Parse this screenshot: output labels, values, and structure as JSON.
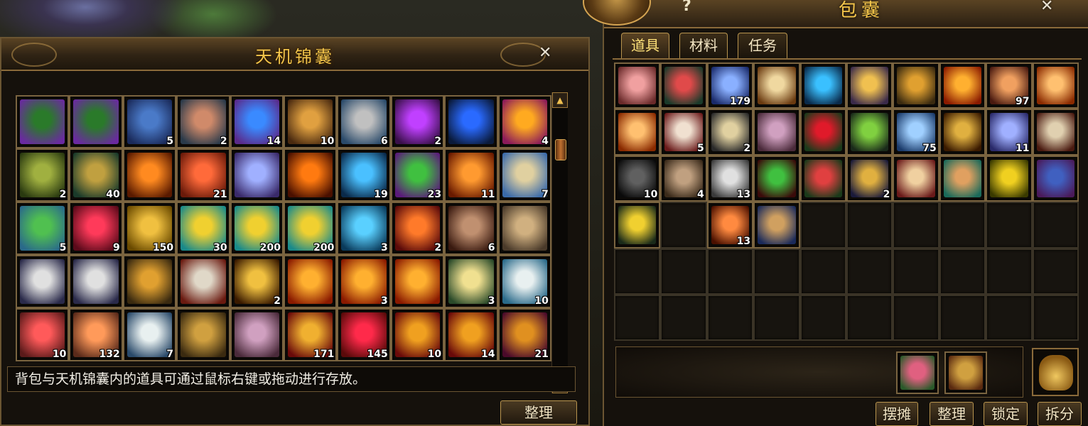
{
  "left_panel": {
    "title": "天机锦囊",
    "close_label": "✕",
    "scroll_up": "▲",
    "scroll_down": "▼",
    "hint": "背包与天机锦囊内的道具可通过鼠标右键或拖动进行存放。",
    "sort_button": "整理",
    "slots": [
      {
        "icon": "green-jade-talisman-icon",
        "count": "",
        "colors": [
          "#2a7a2a",
          "#6a2aa0"
        ]
      },
      {
        "icon": "green-jade-talisman-icon",
        "count": "",
        "colors": [
          "#2a7a2a",
          "#6a2aa0"
        ]
      },
      {
        "icon": "blue-ribbon-icon",
        "count": "5",
        "colors": [
          "#4a7ac8",
          "#1a2a5a"
        ]
      },
      {
        "icon": "pink-ribbon-icon",
        "count": "2",
        "colors": [
          "#d08a6a",
          "#2a3a4a"
        ]
      },
      {
        "icon": "blue-orb-icon",
        "count": "14",
        "colors": [
          "#3a8aff",
          "#5a2a8a"
        ]
      },
      {
        "icon": "golden-orb-icon",
        "count": "10",
        "colors": [
          "#e0a040",
          "#4a2a10"
        ]
      },
      {
        "icon": "jade-ring-icon",
        "count": "6",
        "colors": [
          "#c0c0c0",
          "#2a4a6a"
        ]
      },
      {
        "icon": "purple-gem-icon",
        "count": "2",
        "colors": [
          "#c040ff",
          "#3a104a"
        ]
      },
      {
        "icon": "blue-rune-icon",
        "count": "",
        "colors": [
          "#2a6aff",
          "#0a1a3a"
        ]
      },
      {
        "icon": "fire-swirl-icon",
        "count": "4",
        "colors": [
          "#ffaa20",
          "#8a1a5a"
        ]
      },
      {
        "icon": "bamboo-scroll-icon",
        "count": "2",
        "colors": [
          "#a0b040",
          "#2a3a10"
        ]
      },
      {
        "icon": "bronze-coin-icon",
        "count": "40",
        "colors": [
          "#c0a040",
          "#1a3a2a"
        ]
      },
      {
        "icon": "flame-orb-icon",
        "count": "",
        "colors": [
          "#ff8a20",
          "#5a1a00"
        ]
      },
      {
        "icon": "red-fan-icon",
        "count": "21",
        "colors": [
          "#ff6a3a",
          "#6a1a0a"
        ]
      },
      {
        "icon": "crystal-gem-icon",
        "count": "",
        "colors": [
          "#a0b0ff",
          "#3a2a6a"
        ]
      },
      {
        "icon": "flame-orb-icon",
        "count": "",
        "colors": [
          "#ff7a10",
          "#4a1000"
        ]
      },
      {
        "icon": "water-drop-icon",
        "count": "19",
        "colors": [
          "#4ac0ff",
          "#0a2a4a"
        ]
      },
      {
        "icon": "green-leaf-icon",
        "count": "23",
        "colors": [
          "#40c040",
          "#5a1a7a"
        ]
      },
      {
        "icon": "fire-coins-icon",
        "count": "11",
        "colors": [
          "#ff9a30",
          "#6a1a00"
        ]
      },
      {
        "icon": "paper-scroll-icon",
        "count": "7",
        "colors": [
          "#e0d0a0",
          "#3a6aaa"
        ]
      },
      {
        "icon": "herb-leaf-icon",
        "count": "5",
        "colors": [
          "#50c050",
          "#2a6a8a"
        ]
      },
      {
        "icon": "red-charm-icon",
        "count": "9",
        "colors": [
          "#ff3a5a",
          "#5a0a1a"
        ]
      },
      {
        "icon": "gold-bar-icon",
        "count": "150",
        "colors": [
          "#f0c040",
          "#6a4a00"
        ]
      },
      {
        "icon": "red-seal-scroll-icon",
        "count": "30",
        "colors": [
          "#f0d030",
          "#1a8a8a"
        ]
      },
      {
        "icon": "red-seal-scroll-icon",
        "count": "200",
        "colors": [
          "#f0d030",
          "#1a8a8a"
        ]
      },
      {
        "icon": "red-seal-scroll-icon",
        "count": "200",
        "colors": [
          "#f0d030",
          "#1a8a8a"
        ]
      },
      {
        "icon": "spirit-orb-icon",
        "count": "3",
        "colors": [
          "#5ad0ff",
          "#0a3a5a"
        ]
      },
      {
        "icon": "fire-crystal-icon",
        "count": "2",
        "colors": [
          "#ff7a2a",
          "#5a0a0a"
        ]
      },
      {
        "icon": "ore-rock-icon",
        "count": "6",
        "colors": [
          "#c09070",
          "#3a1a10"
        ]
      },
      {
        "icon": "old-paper-icon",
        "count": "",
        "colors": [
          "#d0b080",
          "#4a3a2a"
        ]
      },
      {
        "icon": "white-gourd-icon",
        "count": "",
        "colors": [
          "#e0e0e0",
          "#2a2a4a"
        ]
      },
      {
        "icon": "white-gourd-icon",
        "count": "",
        "colors": [
          "#e0e0e0",
          "#2a2a4a"
        ]
      },
      {
        "icon": "golden-gourd-icon",
        "count": "",
        "colors": [
          "#e0a030",
          "#3a2a10"
        ]
      },
      {
        "icon": "scroll-roll-icon",
        "count": "",
        "colors": [
          "#e0d8c8",
          "#6a1a10"
        ]
      },
      {
        "icon": "golden-tablet-icon",
        "count": "2",
        "colors": [
          "#f0c040",
          "#3a1a00"
        ]
      },
      {
        "icon": "fire-scroll-icon",
        "count": "",
        "colors": [
          "#ffb030",
          "#8a1a00"
        ]
      },
      {
        "icon": "fire-scroll-icon",
        "count": "3",
        "colors": [
          "#ffb030",
          "#8a1a00"
        ]
      },
      {
        "icon": "fire-scroll-icon",
        "count": "",
        "colors": [
          "#ffb030",
          "#8a1a00"
        ]
      },
      {
        "icon": "rune-paper-icon",
        "count": "3",
        "colors": [
          "#f0e090",
          "#2a4a2a"
        ]
      },
      {
        "icon": "mahjong-tile-icon",
        "count": "10",
        "colors": [
          "#e8f0f0",
          "#2a6a8a"
        ]
      },
      {
        "icon": "red-crystal-icon",
        "count": "10",
        "colors": [
          "#ff5a5a",
          "#5a1a1a"
        ]
      },
      {
        "icon": "orange-crystal-icon",
        "count": "132",
        "colors": [
          "#ff9a5a",
          "#5a2a1a"
        ]
      },
      {
        "icon": "mahjong-tile-icon",
        "count": "7",
        "colors": [
          "#e8f0f0",
          "#2a4a6a"
        ]
      },
      {
        "icon": "golden-cage-icon",
        "count": "",
        "colors": [
          "#d0a040",
          "#3a2a10"
        ]
      },
      {
        "icon": "pink-scroll-icon",
        "count": "",
        "colors": [
          "#d0a0c0",
          "#4a2a3a"
        ]
      },
      {
        "icon": "golden-dragon-icon",
        "count": "171",
        "colors": [
          "#f0b030",
          "#6a0a0a"
        ]
      },
      {
        "icon": "red-ruby-icon",
        "count": "145",
        "colors": [
          "#ff2a4a",
          "#5a0a0a"
        ]
      },
      {
        "icon": "golden-dragon-icon",
        "count": "10",
        "colors": [
          "#f0a020",
          "#6a0a0a"
        ]
      },
      {
        "icon": "golden-dragon-icon",
        "count": "14",
        "colors": [
          "#f0a020",
          "#6a0a0a"
        ]
      },
      {
        "icon": "golden-dragon-icon",
        "count": "21",
        "colors": [
          "#e09020",
          "#4a0a2a"
        ]
      }
    ]
  },
  "right_panel": {
    "title": "包囊",
    "help_label": "?",
    "close_label": "✕",
    "tabs": [
      {
        "label": "道具",
        "active": true
      },
      {
        "label": "材料",
        "active": false
      },
      {
        "label": "任务",
        "active": false
      }
    ],
    "slots": [
      {
        "icon": "pink-card-icon",
        "count": "",
        "colors": [
          "#f0a0a0",
          "#6a2a2a"
        ]
      },
      {
        "icon": "red-flower-icon",
        "count": "",
        "colors": [
          "#e04a4a",
          "#1a3a2a"
        ]
      },
      {
        "icon": "moon-pearl-icon",
        "count": "179",
        "colors": [
          "#8ab0ff",
          "#1a2a6a"
        ]
      },
      {
        "icon": "pearl-pile-icon",
        "count": "",
        "colors": [
          "#f0d8a0",
          "#6a3a10"
        ]
      },
      {
        "icon": "blue-orb-icon",
        "count": "",
        "colors": [
          "#3ac0ff",
          "#0a2a4a"
        ]
      },
      {
        "icon": "golden-map-icon",
        "count": "",
        "colors": [
          "#f0c050",
          "#3a2a4a"
        ]
      },
      {
        "icon": "golden-gourd-icon",
        "count": "",
        "colors": [
          "#e0a030",
          "#3a2a10"
        ]
      },
      {
        "icon": "fire-scroll-icon",
        "count": "",
        "colors": [
          "#ffb030",
          "#8a1a00"
        ]
      },
      {
        "icon": "ore-crystal-icon",
        "count": "97",
        "colors": [
          "#f0a060",
          "#4a1a10"
        ]
      },
      {
        "icon": "pearl-pile-icon",
        "count": "",
        "colors": [
          "#ffc070",
          "#8a2a00"
        ]
      },
      {
        "icon": "pearl-pile-icon",
        "count": "",
        "colors": [
          "#ffc070",
          "#8a2a00"
        ]
      },
      {
        "icon": "colored-balls-icon",
        "count": "5",
        "colors": [
          "#f0e0d0",
          "#6a1a1a"
        ]
      },
      {
        "icon": "parchment-roll-icon",
        "count": "2",
        "colors": [
          "#e0d0a0",
          "#2a2a2a"
        ]
      },
      {
        "icon": "pink-scroll-icon",
        "count": "",
        "colors": [
          "#d0a0c0",
          "#4a2a3a"
        ]
      },
      {
        "icon": "red-rose-icon",
        "count": "",
        "colors": [
          "#e01a2a",
          "#1a3a1a"
        ]
      },
      {
        "icon": "green-sprout-icon",
        "count": "",
        "colors": [
          "#80d040",
          "#1a2a1a"
        ]
      },
      {
        "icon": "lightning-icon",
        "count": "75",
        "colors": [
          "#a0d0ff",
          "#1a3a6a"
        ]
      },
      {
        "icon": "shield-rune-icon",
        "count": "",
        "colors": [
          "#e0b040",
          "#3a1a00"
        ]
      },
      {
        "icon": "blue-scroll-icon",
        "count": "11",
        "colors": [
          "#a0b0ff",
          "#2a2a6a"
        ]
      },
      {
        "icon": "paper-sheet-icon",
        "count": "",
        "colors": [
          "#e0d0b0",
          "#4a1a10"
        ]
      },
      {
        "icon": "coal-lump-icon",
        "count": "10",
        "colors": [
          "#606060",
          "#0a0a0a"
        ]
      },
      {
        "icon": "cloth-roll-icon",
        "count": "4",
        "colors": [
          "#c0a080",
          "#3a2a1a"
        ]
      },
      {
        "icon": "silver-ore-icon",
        "count": "13",
        "colors": [
          "#e0e0e0",
          "#3a3a3a"
        ]
      },
      {
        "icon": "green-mat-icon",
        "count": "",
        "colors": [
          "#40c040",
          "#3a0a0a"
        ]
      },
      {
        "icon": "red-mat-icon",
        "count": "",
        "colors": [
          "#e04040",
          "#1a3a1a"
        ]
      },
      {
        "icon": "coffin-icon",
        "count": "2",
        "colors": [
          "#e0b040",
          "#1a1a3a"
        ]
      },
      {
        "icon": "letter-scroll-icon",
        "count": "",
        "colors": [
          "#f0d0a0",
          "#6a1a1a"
        ]
      },
      {
        "icon": "ox-head-icon",
        "count": "",
        "colors": [
          "#e0a060",
          "#1a6a5a"
        ]
      },
      {
        "icon": "gold-box-icon",
        "count": "",
        "colors": [
          "#f0d020",
          "#3a3a00"
        ]
      },
      {
        "icon": "blue-book-icon",
        "count": "",
        "colors": [
          "#4060c0",
          "#4a1a5a"
        ]
      },
      {
        "icon": "golden-egg-icon",
        "count": "",
        "colors": [
          "#f0d030",
          "#1a2a1a"
        ]
      },
      {
        "icon": "",
        "count": "",
        "colors": []
      },
      {
        "icon": "fire-rose-icon",
        "count": "13",
        "colors": [
          "#ff8a40",
          "#4a1000"
        ]
      },
      {
        "icon": "bead-bag-icon",
        "count": "",
        "colors": [
          "#d0a060",
          "#1a2a5a"
        ]
      },
      {
        "icon": "",
        "count": "",
        "colors": []
      },
      {
        "icon": "",
        "count": "",
        "colors": []
      },
      {
        "icon": "",
        "count": "",
        "colors": []
      },
      {
        "icon": "",
        "count": "",
        "colors": []
      },
      {
        "icon": "",
        "count": "",
        "colors": []
      },
      {
        "icon": "",
        "count": "",
        "colors": []
      },
      {
        "icon": "",
        "count": "",
        "colors": []
      },
      {
        "icon": "",
        "count": "",
        "colors": []
      },
      {
        "icon": "",
        "count": "",
        "colors": []
      },
      {
        "icon": "",
        "count": "",
        "colors": []
      },
      {
        "icon": "",
        "count": "",
        "colors": []
      },
      {
        "icon": "",
        "count": "",
        "colors": []
      },
      {
        "icon": "",
        "count": "",
        "colors": []
      },
      {
        "icon": "",
        "count": "",
        "colors": []
      },
      {
        "icon": "",
        "count": "",
        "colors": []
      },
      {
        "icon": "",
        "count": "",
        "colors": []
      },
      {
        "icon": "",
        "count": "",
        "colors": []
      },
      {
        "icon": "",
        "count": "",
        "colors": []
      },
      {
        "icon": "",
        "count": "",
        "colors": []
      },
      {
        "icon": "",
        "count": "",
        "colors": []
      },
      {
        "icon": "",
        "count": "",
        "colors": []
      },
      {
        "icon": "",
        "count": "",
        "colors": []
      },
      {
        "icon": "",
        "count": "",
        "colors": []
      },
      {
        "icon": "",
        "count": "",
        "colors": []
      },
      {
        "icon": "",
        "count": "",
        "colors": []
      },
      {
        "icon": "",
        "count": "",
        "colors": []
      }
    ],
    "quick_items": [
      {
        "icon": "flower-pouch-icon",
        "colors": [
          "#e06080",
          "#2a5a2a"
        ]
      },
      {
        "icon": "treasure-chest-icon",
        "colors": [
          "#d0a040",
          "#5a2a10"
        ]
      }
    ],
    "bag_icon": "bag-icon",
    "buttons": {
      "stall": "摆摊",
      "sort": "整理",
      "lock": "锁定",
      "split": "拆分"
    }
  }
}
